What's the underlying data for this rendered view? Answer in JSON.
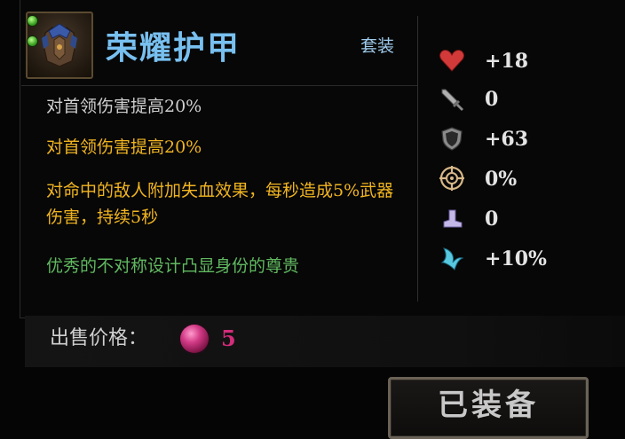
{
  "item": {
    "name": "荣耀护甲",
    "set_tag": "套装",
    "icon": "armor-icon",
    "gem_sockets": 2,
    "gem_socket_color": "#3aa020"
  },
  "effects": [
    {
      "text": "对首领伤害提高20%",
      "color": "#cfcfcf"
    },
    {
      "text": "对首领伤害提高20%",
      "color": "#f0b420"
    },
    {
      "text": "对命中的敌人附加失血效果，每秒造成5%武器伤害，持续5秒",
      "color": "#f0b420"
    },
    {
      "text": "优秀的不对称设计凸显身份的尊贵",
      "color": "#60b860"
    }
  ],
  "stats": [
    {
      "icon": "heart-icon",
      "value": "+18"
    },
    {
      "icon": "sword-icon",
      "value": "0"
    },
    {
      "icon": "shield-icon",
      "value": "+63"
    },
    {
      "icon": "crit-target-icon",
      "value": "0%"
    },
    {
      "icon": "boot-icon",
      "value": "0"
    },
    {
      "icon": "claw-icon",
      "value": "+10%"
    }
  ],
  "price": {
    "label": "出售价格：",
    "value": "5",
    "currency_icon": "pink-gem-icon",
    "value_color": "#d22c7a"
  },
  "equip_button": {
    "label": "已装备"
  }
}
